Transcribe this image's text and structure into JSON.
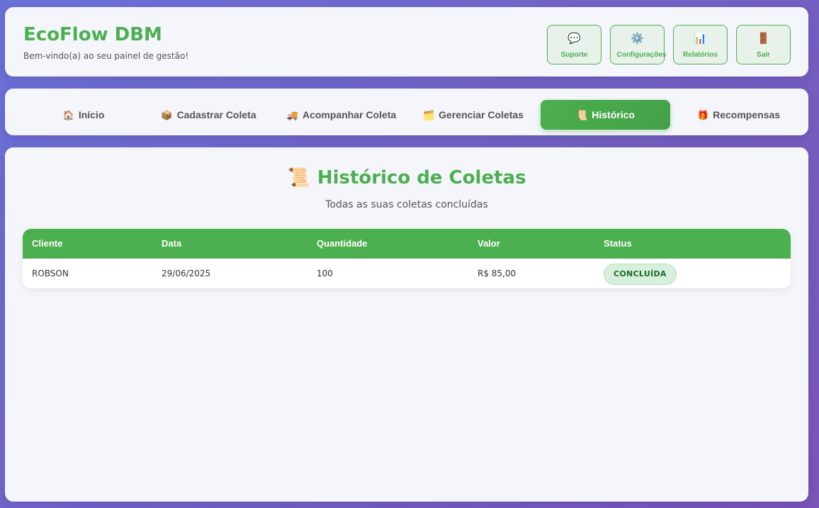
{
  "header": {
    "title": "EcoFlow DBM",
    "welcome": "Bem-vindo(a) ao seu painel de gestão!",
    "buttons": [
      {
        "icon": "💬",
        "icon_name": "speech-bubble-icon",
        "label": "Suporte"
      },
      {
        "icon": "⚙️",
        "icon_name": "gear-icon",
        "label": "Configurações"
      },
      {
        "icon": "📊",
        "icon_name": "bar-chart-icon",
        "label": "Relatórios"
      },
      {
        "icon": "🚪",
        "icon_name": "door-icon",
        "label": "Sair"
      }
    ]
  },
  "nav": {
    "active": "Histórico",
    "tabs": [
      {
        "icon": "🏠",
        "icon_name": "house-icon",
        "label": "Início"
      },
      {
        "icon": "📦",
        "icon_name": "package-icon",
        "label": "Cadastrar Coleta"
      },
      {
        "icon": "🚚",
        "icon_name": "truck-icon",
        "label": "Acompanhar Coleta"
      },
      {
        "icon": "🗂️",
        "icon_name": "folder-icon",
        "label": "Gerenciar Coletas"
      },
      {
        "icon": "📜",
        "icon_name": "scroll-icon",
        "label": "Histórico"
      },
      {
        "icon": "🎁",
        "icon_name": "gift-icon",
        "label": "Recompensas"
      }
    ]
  },
  "main": {
    "icon": "📜",
    "title": "Histórico de Coletas",
    "subtitle": "Todas as suas coletas concluídas",
    "table": {
      "columns": [
        "Cliente",
        "Data",
        "Quantidade",
        "Valor",
        "Status"
      ],
      "rows": [
        {
          "cliente": "ROBSON",
          "data": "29/06/2025",
          "quantidade": "100",
          "valor": "R$ 85,00",
          "status": "CONCLUÍDA"
        }
      ]
    }
  },
  "colors": {
    "accent": "#4caf50",
    "background_start": "#6a72d8",
    "background_end": "#7a55b8",
    "badge_bg": "#d7efdc"
  }
}
